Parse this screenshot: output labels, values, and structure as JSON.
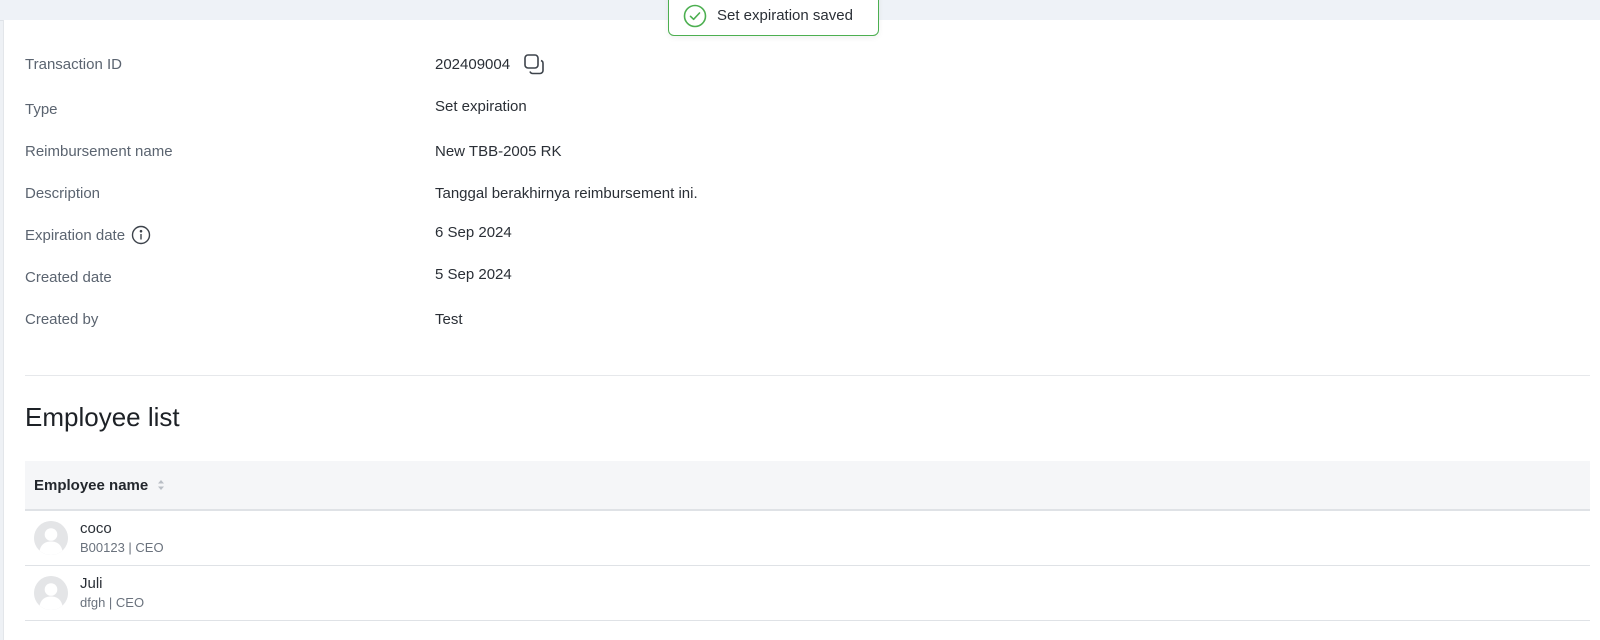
{
  "toast": {
    "message": "Set expiration saved",
    "icon": "check-circle-icon",
    "accent_color": "#4caf50"
  },
  "details": {
    "transaction_id": {
      "label": "Transaction ID",
      "value": "202409004",
      "icon": "copy-icon"
    },
    "type": {
      "label": "Type",
      "value": "Set expiration"
    },
    "reimbursement_name": {
      "label": "Reimbursement name",
      "value": "New TBB-2005 RK"
    },
    "description": {
      "label": "Description",
      "value": "Tanggal berakhirnya reimbursement ini."
    },
    "expiration_date": {
      "label": "Expiration date",
      "value": "6 Sep 2024",
      "icon": "info-icon"
    },
    "created_date": {
      "label": "Created date",
      "value": "5 Sep 2024"
    },
    "created_by": {
      "label": "Created by",
      "value": "Test"
    }
  },
  "employee_list": {
    "title": "Employee list",
    "columns": [
      {
        "label": "Employee name",
        "sort_icon": "sort-icon"
      }
    ],
    "rows": [
      {
        "name": "coco",
        "sub": "B00123 | CEO",
        "avatar": "avatar-placeholder-icon"
      },
      {
        "name": "Juli",
        "sub": "dfgh | CEO",
        "avatar": "avatar-placeholder-icon"
      }
    ]
  }
}
